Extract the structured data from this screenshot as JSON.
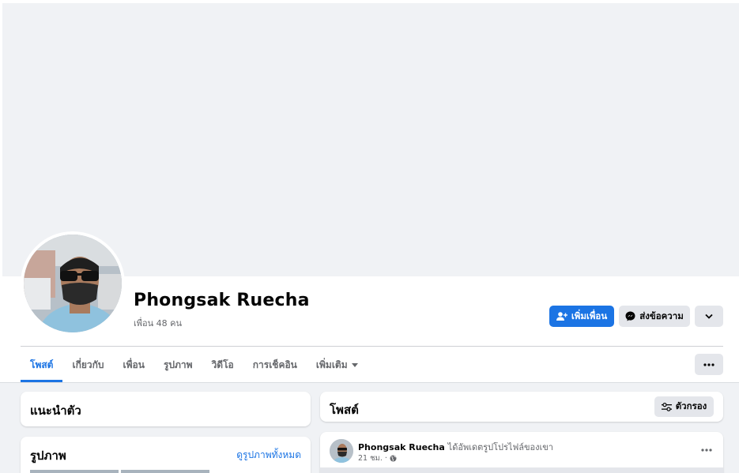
{
  "profile": {
    "name": "Phongsak Ruecha",
    "friends": "เพื่อน 48 คน"
  },
  "actions": {
    "add_friend": "เพิ่มเพื่อน",
    "message": "ส่งข้อความ"
  },
  "tabs": [
    {
      "label": "โพสต์",
      "active": true
    },
    {
      "label": "เกี่ยวกับ"
    },
    {
      "label": "เพื่อน"
    },
    {
      "label": "รูปภาพ"
    },
    {
      "label": "วิดีโอ"
    },
    {
      "label": "การเช็คอิน"
    },
    {
      "label": "เพิ่มเติม"
    }
  ],
  "intro": {
    "title": "แนะนำตัว"
  },
  "photos": {
    "title": "รูปภาพ",
    "see_all": "ดูรูปภาพทั้งหมด"
  },
  "posts": {
    "title": "โพสต์",
    "filter": "ตัวกรอง"
  },
  "post": {
    "author": "Phongsak Ruecha",
    "action": "ได้อัพเดตรูปโปรไฟล์ของเขา",
    "time": "21 ชม. ·"
  },
  "colors": {
    "accent": "#1b74e4",
    "background": "#f0f2f5",
    "button_gray": "#e4e6eb"
  }
}
